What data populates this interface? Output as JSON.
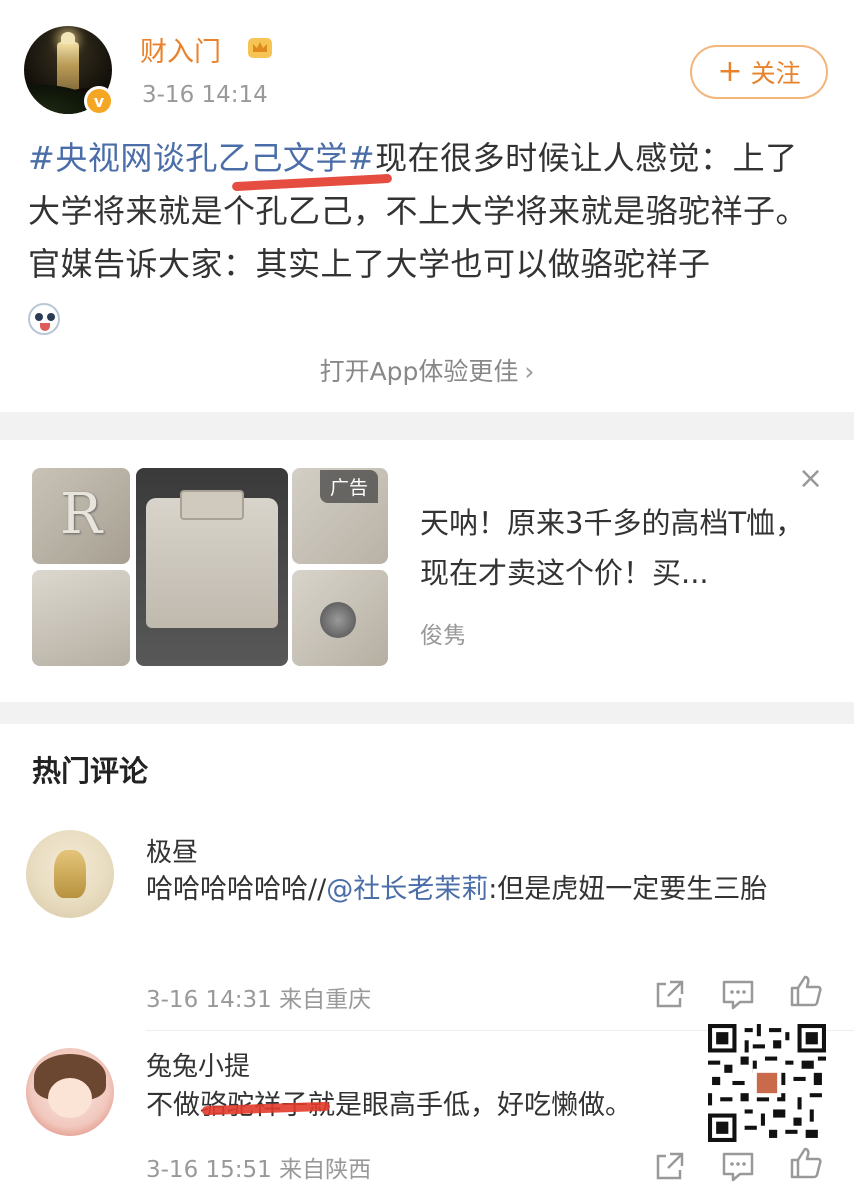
{
  "post": {
    "username": "财入门",
    "time": "3-16 14:14",
    "follow_label": "关注",
    "topic": "#央视网谈孔乙己文学#",
    "text": "现在很多时候让人感觉：上了大学将来就是个孔乙己，不上大学将来就是骆驼祥子。官媒告诉大家：其实上了大学也可以做骆驼祥子",
    "open_app": "打开App体验更佳"
  },
  "ad": {
    "tag": "广告",
    "title": "天呐！原来3千多的高档T恤，现在才卖这个价！买...",
    "source": "俊隽",
    "image_letter": "R"
  },
  "comments_section": {
    "title": "热门评论",
    "items": [
      {
        "name": "极昼",
        "text_before": "哈哈哈哈哈哈//",
        "mention": "@社长老茉莉",
        "text_after": ":但是虎妞一定要生三胎",
        "meta": "3-16 14:31 来自重庆"
      },
      {
        "name": "兔兔小提",
        "text": "不做骆驼祥子就是眼高手低，好吃懒做。",
        "meta": "3-16 15:51 来自陕西"
      }
    ]
  },
  "colors": {
    "brand_orange": "#e9822b",
    "link_blue": "#4b6ea8",
    "mark_red": "#e23a2b"
  },
  "icons": [
    "verified-badge-icon",
    "crown-icon",
    "plus-icon",
    "chevron-right-icon",
    "close-icon",
    "share-icon",
    "comment-icon",
    "like-icon",
    "qr-code-icon"
  ]
}
